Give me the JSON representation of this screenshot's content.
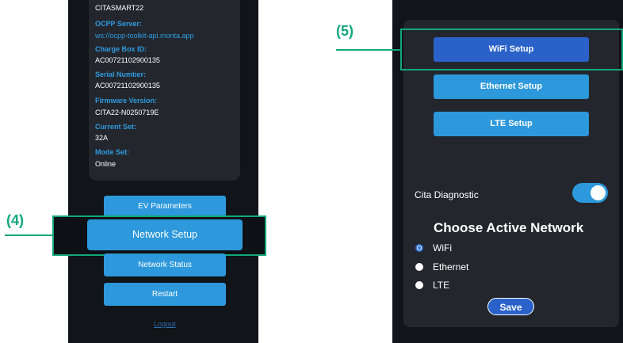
{
  "colors": {
    "app_background": "#111418",
    "card": "#23272d",
    "accent_blue": "#2d98db",
    "active_blue": "#2a62c9",
    "label_blue": "#2e9be0",
    "annotation_green": "#12a87a"
  },
  "left_screen": {
    "info": {
      "top_value": "CITASMART22",
      "ocpp_label": "OCPP Server:",
      "ocpp_value": "ws://ocpp-toolkit-api.monta.app",
      "charge_box_label": "Charge Box ID:",
      "charge_box_value": "AC00721102900135",
      "serial_label": "Serial Number:",
      "serial_value": "AC00721102900135",
      "firmware_label": "Firmware Version:",
      "firmware_value": "CITA22-N0250719E",
      "current_label": "Current Set:",
      "current_value": "32A",
      "mode_label": "Mode Set:",
      "mode_value": "Online"
    },
    "buttons": {
      "ev_parameters": "EV Parameters",
      "network_setup": "Network Setup",
      "network_status": "Network Status",
      "restart": "Restart"
    },
    "logout": "Logout"
  },
  "right_screen": {
    "buttons": {
      "wifi_setup": "WiFi Setup",
      "ethernet_setup": "Ethernet Setup",
      "lte_setup": "LTE Setup"
    },
    "diagnostic": {
      "label": "Cita Diagnostic",
      "enabled": true
    },
    "network_choice": {
      "title": "Choose Active Network",
      "options": [
        "WiFi",
        "Ethernet",
        "LTE"
      ],
      "selected": "WiFi"
    },
    "save": "Save"
  },
  "annotations": {
    "step4": "(4)",
    "step5": "(5)"
  }
}
